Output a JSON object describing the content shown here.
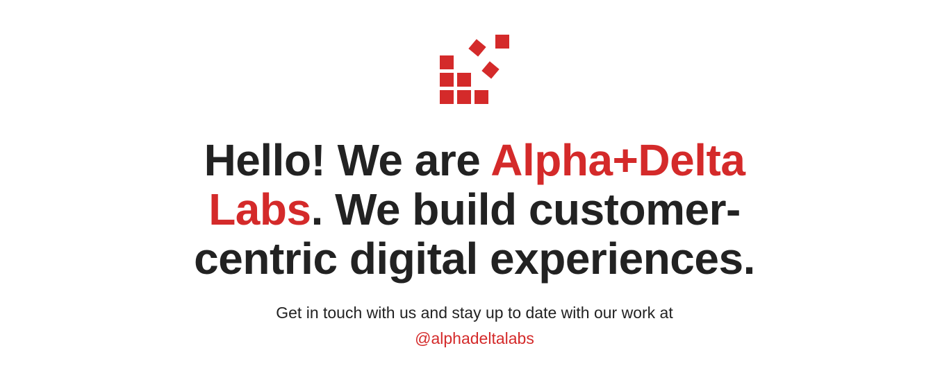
{
  "brand": {
    "logo_icon": "alpha-delta-blocks-logo-icon",
    "accent_color": "#d42a2a",
    "text_color": "#222222"
  },
  "hero": {
    "headline_part1": "Hello! We are ",
    "headline_brand": "Alpha+Delta Labs",
    "headline_part2": ". We build customer-centric digital experiences."
  },
  "contact": {
    "text": "Get in touch with us and stay up to date with our work at",
    "handle": "@alphadeltalabs"
  }
}
